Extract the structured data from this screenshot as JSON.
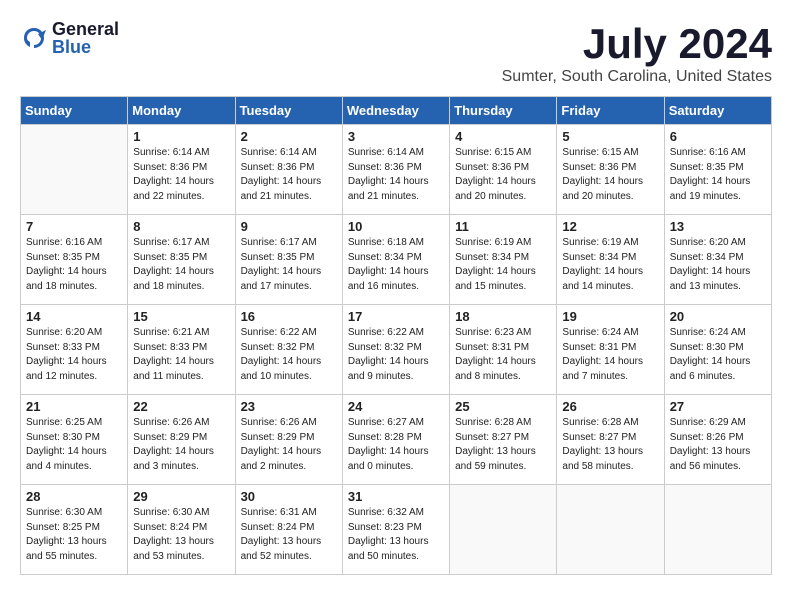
{
  "logo": {
    "general": "General",
    "blue": "Blue"
  },
  "header": {
    "month": "July 2024",
    "location": "Sumter, South Carolina, United States"
  },
  "weekdays": [
    "Sunday",
    "Monday",
    "Tuesday",
    "Wednesday",
    "Thursday",
    "Friday",
    "Saturday"
  ],
  "weeks": [
    [
      {
        "day": "",
        "content": ""
      },
      {
        "day": "1",
        "content": "Sunrise: 6:14 AM\nSunset: 8:36 PM\nDaylight: 14 hours\nand 22 minutes."
      },
      {
        "day": "2",
        "content": "Sunrise: 6:14 AM\nSunset: 8:36 PM\nDaylight: 14 hours\nand 21 minutes."
      },
      {
        "day": "3",
        "content": "Sunrise: 6:14 AM\nSunset: 8:36 PM\nDaylight: 14 hours\nand 21 minutes."
      },
      {
        "day": "4",
        "content": "Sunrise: 6:15 AM\nSunset: 8:36 PM\nDaylight: 14 hours\nand 20 minutes."
      },
      {
        "day": "5",
        "content": "Sunrise: 6:15 AM\nSunset: 8:36 PM\nDaylight: 14 hours\nand 20 minutes."
      },
      {
        "day": "6",
        "content": "Sunrise: 6:16 AM\nSunset: 8:35 PM\nDaylight: 14 hours\nand 19 minutes."
      }
    ],
    [
      {
        "day": "7",
        "content": "Sunrise: 6:16 AM\nSunset: 8:35 PM\nDaylight: 14 hours\nand 18 minutes."
      },
      {
        "day": "8",
        "content": "Sunrise: 6:17 AM\nSunset: 8:35 PM\nDaylight: 14 hours\nand 18 minutes."
      },
      {
        "day": "9",
        "content": "Sunrise: 6:17 AM\nSunset: 8:35 PM\nDaylight: 14 hours\nand 17 minutes."
      },
      {
        "day": "10",
        "content": "Sunrise: 6:18 AM\nSunset: 8:34 PM\nDaylight: 14 hours\nand 16 minutes."
      },
      {
        "day": "11",
        "content": "Sunrise: 6:19 AM\nSunset: 8:34 PM\nDaylight: 14 hours\nand 15 minutes."
      },
      {
        "day": "12",
        "content": "Sunrise: 6:19 AM\nSunset: 8:34 PM\nDaylight: 14 hours\nand 14 minutes."
      },
      {
        "day": "13",
        "content": "Sunrise: 6:20 AM\nSunset: 8:34 PM\nDaylight: 14 hours\nand 13 minutes."
      }
    ],
    [
      {
        "day": "14",
        "content": "Sunrise: 6:20 AM\nSunset: 8:33 PM\nDaylight: 14 hours\nand 12 minutes."
      },
      {
        "day": "15",
        "content": "Sunrise: 6:21 AM\nSunset: 8:33 PM\nDaylight: 14 hours\nand 11 minutes."
      },
      {
        "day": "16",
        "content": "Sunrise: 6:22 AM\nSunset: 8:32 PM\nDaylight: 14 hours\nand 10 minutes."
      },
      {
        "day": "17",
        "content": "Sunrise: 6:22 AM\nSunset: 8:32 PM\nDaylight: 14 hours\nand 9 minutes."
      },
      {
        "day": "18",
        "content": "Sunrise: 6:23 AM\nSunset: 8:31 PM\nDaylight: 14 hours\nand 8 minutes."
      },
      {
        "day": "19",
        "content": "Sunrise: 6:24 AM\nSunset: 8:31 PM\nDaylight: 14 hours\nand 7 minutes."
      },
      {
        "day": "20",
        "content": "Sunrise: 6:24 AM\nSunset: 8:30 PM\nDaylight: 14 hours\nand 6 minutes."
      }
    ],
    [
      {
        "day": "21",
        "content": "Sunrise: 6:25 AM\nSunset: 8:30 PM\nDaylight: 14 hours\nand 4 minutes."
      },
      {
        "day": "22",
        "content": "Sunrise: 6:26 AM\nSunset: 8:29 PM\nDaylight: 14 hours\nand 3 minutes."
      },
      {
        "day": "23",
        "content": "Sunrise: 6:26 AM\nSunset: 8:29 PM\nDaylight: 14 hours\nand 2 minutes."
      },
      {
        "day": "24",
        "content": "Sunrise: 6:27 AM\nSunset: 8:28 PM\nDaylight: 14 hours\nand 0 minutes."
      },
      {
        "day": "25",
        "content": "Sunrise: 6:28 AM\nSunset: 8:27 PM\nDaylight: 13 hours\nand 59 minutes."
      },
      {
        "day": "26",
        "content": "Sunrise: 6:28 AM\nSunset: 8:27 PM\nDaylight: 13 hours\nand 58 minutes."
      },
      {
        "day": "27",
        "content": "Sunrise: 6:29 AM\nSunset: 8:26 PM\nDaylight: 13 hours\nand 56 minutes."
      }
    ],
    [
      {
        "day": "28",
        "content": "Sunrise: 6:30 AM\nSunset: 8:25 PM\nDaylight: 13 hours\nand 55 minutes."
      },
      {
        "day": "29",
        "content": "Sunrise: 6:30 AM\nSunset: 8:24 PM\nDaylight: 13 hours\nand 53 minutes."
      },
      {
        "day": "30",
        "content": "Sunrise: 6:31 AM\nSunset: 8:24 PM\nDaylight: 13 hours\nand 52 minutes."
      },
      {
        "day": "31",
        "content": "Sunrise: 6:32 AM\nSunset: 8:23 PM\nDaylight: 13 hours\nand 50 minutes."
      },
      {
        "day": "",
        "content": ""
      },
      {
        "day": "",
        "content": ""
      },
      {
        "day": "",
        "content": ""
      }
    ]
  ]
}
